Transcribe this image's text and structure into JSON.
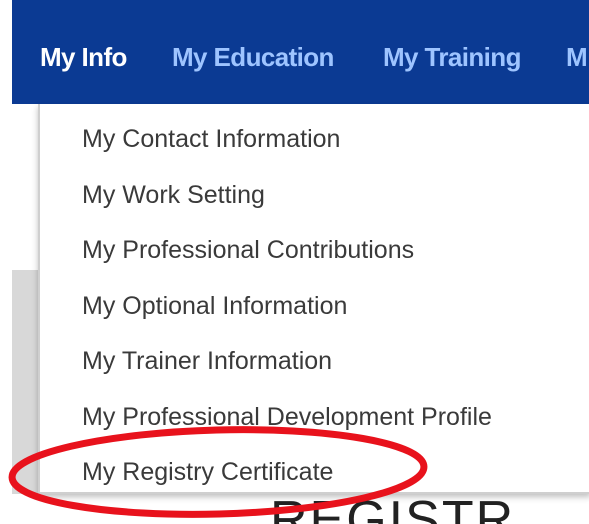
{
  "nav": {
    "items": [
      {
        "label": "My Info",
        "active": true
      },
      {
        "label": "My Education",
        "active": false
      },
      {
        "label": "My Training",
        "active": false
      },
      {
        "label": "M",
        "active": false
      }
    ]
  },
  "dropdown": {
    "items": [
      {
        "label": "My Contact Information"
      },
      {
        "label": "My Work Setting"
      },
      {
        "label": "My Professional Contributions"
      },
      {
        "label": "My Optional Information"
      },
      {
        "label": "My Trainer Information"
      },
      {
        "label": "My Professional Development Profile"
      },
      {
        "label": "My Registry Certificate",
        "highlighted": true
      }
    ]
  },
  "background": {
    "partial_text": "REGISTR"
  },
  "colors": {
    "navbar": "#0b3a93",
    "nav_active": "#ffffff",
    "nav_inactive": "#9ec4ff",
    "menu_text": "#3a3a3a",
    "highlight": "#e8121c"
  }
}
